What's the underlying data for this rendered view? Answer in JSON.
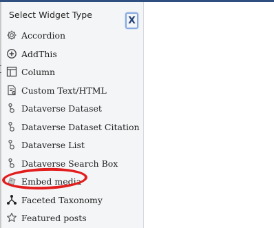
{
  "dialog": {
    "title": "Select Widget Type",
    "close_label": "X"
  },
  "widgets": [
    {
      "label": "Accordion",
      "icon": "gear-icon"
    },
    {
      "label": "AddThis",
      "icon": "add-circle-icon"
    },
    {
      "label": "Column",
      "icon": "column-layout-icon"
    },
    {
      "label": "Custom Text/HTML",
      "icon": "custom-html-icon"
    },
    {
      "label": "Dataverse Dataset",
      "icon": "dataverse-node-icon"
    },
    {
      "label": "Dataverse Dataset Citation",
      "icon": "dataverse-node-icon"
    },
    {
      "label": "Dataverse List",
      "icon": "dataverse-node-icon"
    },
    {
      "label": "Dataverse Search Box",
      "icon": "dataverse-node-icon"
    },
    {
      "label": "Embed media",
      "icon": "embed-media-icon"
    },
    {
      "label": "Faceted Taxonomy",
      "icon": "taxonomy-icon"
    },
    {
      "label": "Featured posts",
      "icon": "star-icon"
    }
  ],
  "colors": {
    "highlight": "#e21d1d",
    "header_bar": "#2f4f80",
    "close_border": "#86a9e0",
    "close_text": "#24407a"
  }
}
